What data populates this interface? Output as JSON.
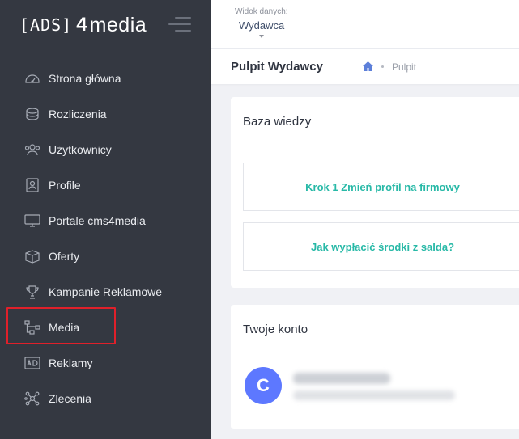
{
  "logo": {
    "part1": "[ADS]",
    "part2": "4",
    "part3": "media"
  },
  "sidebar": {
    "items": [
      {
        "label": "Strona główna",
        "icon": "dashboard-icon"
      },
      {
        "label": "Rozliczenia",
        "icon": "coins-icon"
      },
      {
        "label": "Użytkownicy",
        "icon": "users-icon"
      },
      {
        "label": "Profile",
        "icon": "profile-icon"
      },
      {
        "label": "Portale cms4media",
        "icon": "monitor-icon"
      },
      {
        "label": "Oferty",
        "icon": "box-icon"
      },
      {
        "label": "Kampanie Reklamowe",
        "icon": "trophy-icon"
      },
      {
        "label": "Media",
        "icon": "network-icon"
      },
      {
        "label": "Reklamy",
        "icon": "ad-icon"
      },
      {
        "label": "Zlecenia",
        "icon": "share-nodes-icon"
      }
    ],
    "highlighted": "Media"
  },
  "topbar": {
    "view_label": "Widok danych:",
    "view_value": "Wydawca"
  },
  "subheader": {
    "title": "Pulpit Wydawcy",
    "breadcrumb": "Pulpit"
  },
  "knowledge": {
    "title": "Baza wiedzy",
    "links": [
      "Krok 1 Zmień profil na firmowy",
      "Jak wypłacić środki z salda?"
    ]
  },
  "account": {
    "title": "Twoje konto",
    "avatar_letter": "C"
  },
  "colors": {
    "sidebar_bg": "#343841",
    "accent_link": "#28b9a7",
    "avatar": "#5d78ff",
    "highlight": "#e0202a"
  }
}
